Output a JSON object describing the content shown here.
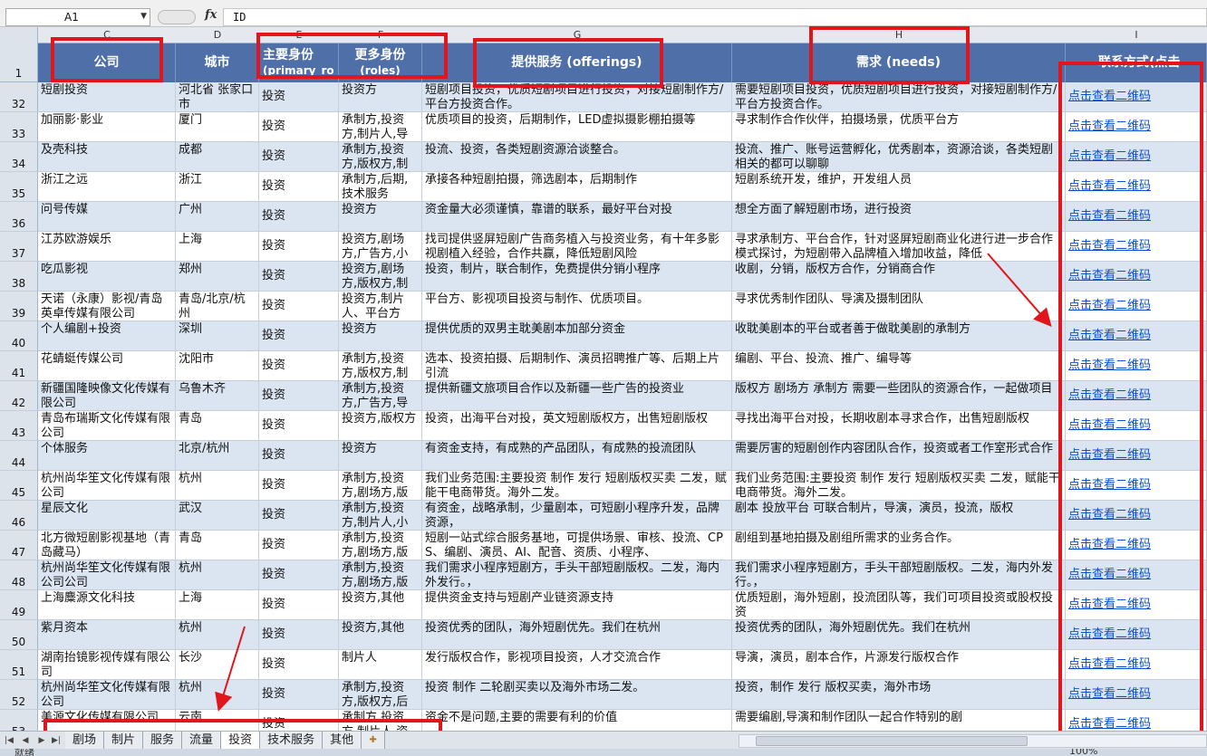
{
  "formula_bar": {
    "cell_ref": "A1",
    "fx": "fx",
    "value": "ID"
  },
  "column_letters": [
    "C",
    "D",
    "E",
    "F",
    "G",
    "H",
    "I"
  ],
  "headers": {
    "company": "公司",
    "city": "城市",
    "primary_line1": "主要身份",
    "primary_line2": "(primary_ro",
    "roles_line1": "更多身份",
    "roles_line2": "(roles)",
    "offerings": "提供服务 (offerings)",
    "needs": "需求 (needs)",
    "contact": "联系方式(点击"
  },
  "header_row_number": "1",
  "link_text": "点击查看二维码",
  "rows": [
    {
      "n": "32",
      "company": "短剧投资",
      "city": "河北省 张家口市",
      "primary": "投资",
      "roles": "投资方",
      "offer": "短剧项目投资，优质短剧项目进行投资，对接短剧制作方/平台方投资合作。",
      "need": "需要短剧项目投资，优质短剧项目进行投资，对接短剧制作方/平台方投资合作。"
    },
    {
      "n": "33",
      "company": "加丽影·影业",
      "city": "厦门",
      "primary": "投资",
      "roles": "承制方,投资方,制片人,导",
      "offer": "优质项目的投资，后期制作，LED虚拟摄影棚拍摄等",
      "need": "寻求制作合作伙伴，拍摄场景，优质平台方"
    },
    {
      "n": "34",
      "company": "及壳科技",
      "city": "成都",
      "primary": "投资",
      "roles": "承制方,投资方,版权方,制",
      "offer": "投流、投资，各类短剧资源洽谈整合。",
      "need": "投流、推广、账号运营孵化，优秀剧本，资源洽谈，各类短剧相关的都可以聊聊"
    },
    {
      "n": "35",
      "company": "浙江之远",
      "city": "浙江",
      "primary": "投资",
      "roles": "承制方,后期,技术服务",
      "offer": "承接各种短剧拍摄，筛选剧本，后期制作",
      "need": "短剧系统开发，维护，开发组人员"
    },
    {
      "n": "36",
      "company": "问号传媒",
      "city": "广州",
      "primary": "投资",
      "roles": "投资方",
      "offer": "资金量大必须谨慎，靠谱的联系，最好平台对投",
      "need": "想全方面了解短剧市场，进行投资"
    },
    {
      "n": "37",
      "company": "江苏欧游娱乐",
      "city": "上海",
      "primary": "投资",
      "roles": "投资方,剧场方,广告方,小",
      "offer": "找司提供竖屏短剧广告商务植入与投资业务，有十年多影视剧植入经验，合作共赢，降低短剧风险",
      "need": "寻求承制方、平台合作，针对竖屏短剧商业化进行进一步合作模式探讨，为短剧带入品牌植入增加收益，降低"
    },
    {
      "n": "38",
      "company": "吃瓜影视",
      "city": "郑州",
      "primary": "投资",
      "roles": "投资方,剧场方,版权方,制",
      "offer": "投资，制片，联合制作，免费提供分销小程序",
      "need": "收剧，分销，版权方合作，分销商合作"
    },
    {
      "n": "39",
      "company": "天诺（永康）影视/青岛英卓传媒有限公司",
      "city": "青岛/北京/杭州",
      "primary": "投资",
      "roles": "投资方,制片人、平台方",
      "offer": "平台方、影视项目投资与制作、优质项目。",
      "need": "寻求优秀制作团队、导演及摄制团队"
    },
    {
      "n": "40",
      "company": "个人编剧+投资",
      "city": "深圳",
      "primary": "投资",
      "roles": "投资方",
      "offer": "提供优质的双男主耽美剧本加部分资金",
      "need": "收耽美剧本的平台或者善于做耽美剧的承制方"
    },
    {
      "n": "41",
      "company": "花蜻蜓传媒公司",
      "city": "沈阳市",
      "primary": "投资",
      "roles": "承制方,投资方,版权方,制",
      "offer": "选本、投资拍摄、后期制作、演员招聘推广等、后期上片引流",
      "need": "编剧、平台、投流、推广、编导等"
    },
    {
      "n": "42",
      "company": "新疆国隆映像文化传媒有限公司",
      "city": "乌鲁木齐",
      "primary": "投资",
      "roles": "承制方,投资方,广告方,导",
      "offer": "提供新疆文旅项目合作以及新疆一些广告的投资业",
      "need": "版权方 剧场方 承制方 需要一些团队的资源合作，一起做项目"
    },
    {
      "n": "43",
      "company": "青岛布瑞斯文化传媒有限公司",
      "city": "青岛",
      "primary": "投资",
      "roles": "投资方,版权方",
      "offer": "投资，出海平台对投，英文短剧版权方，出售短剧版权",
      "need": "寻找出海平台对投，长期收剧本寻求合作，出售短剧版权"
    },
    {
      "n": "44",
      "company": "个体服务",
      "city": "北京/杭州",
      "primary": "投资",
      "roles": "投资方",
      "offer": "有资金支持，有成熟的产品团队，有成熟的投流团队",
      "need": "需要厉害的短剧创作内容团队合作，投资或者工作室形式合作"
    },
    {
      "n": "45",
      "company": "杭州尚华笙文化传媒有限公司",
      "city": "杭州",
      "primary": "投资",
      "roles": "承制方,投资方,剧场方,版",
      "offer": "我们业务范围:主要投资 制作 发行 短剧版权买卖 二发，赋能干电商带货。海外二发。",
      "need": "我们业务范围:主要投资 制作 发行 短剧版权买卖 二发，赋能干电商带货。海外二发。"
    },
    {
      "n": "46",
      "company": "星辰文化",
      "city": "武汉",
      "primary": "投资",
      "roles": "承制方,投资方,制片人,小",
      "offer": "有资金，战略承制，少量剧本，可短剧小程序升发，品牌资源，",
      "need": "剧本 投放平台 可联合制片，导演，演员，投流，版权"
    },
    {
      "n": "47",
      "company": "北方微短剧影视基地（青岛藏马）",
      "city": "青岛",
      "primary": "投资",
      "roles": "承制方,投资方,剧场方,版",
      "offer": "短剧一站式综合服务基地，可提供场景、审核、投流、CPS、编剧、演员、AI、配音、资质、小程序、",
      "need": "剧组到基地拍摄及剧组所需求的业务合作。"
    },
    {
      "n": "48",
      "company": "杭州尚华笙文化传媒有限公司公司",
      "city": "杭州",
      "primary": "投资",
      "roles": "承制方,投资方,剧场方,版",
      "offer": "我们需求小程序短剧方，手头干部短剧版权。二发，海内外发行。，",
      "need": "我们需求小程序短剧方，手头干部短剧版权。二发，海内外发行。，"
    },
    {
      "n": "49",
      "company": "上海麋源文化科技",
      "city": "上海",
      "primary": "投资",
      "roles": "投资方,其他",
      "offer": "提供资金支持与短剧产业链资源支持",
      "need": "优质短剧，海外短剧，投流团队等，我们可项目投资或股权投资"
    },
    {
      "n": "50",
      "company": "紫月资本",
      "city": "杭州",
      "primary": "投资",
      "roles": "投资方,其他",
      "offer": "投资优秀的团队，海外短剧优先。我们在杭州",
      "need": "投资优秀的团队，海外短剧优先。我们在杭州"
    },
    {
      "n": "51",
      "company": "湖南抬镜影视传媒有限公司",
      "city": "长沙",
      "primary": "投资",
      "roles": "制片人",
      "offer": "发行版权合作，影视项目投资，人才交流合作",
      "need": "导演，演员，剧本合作，片源发行版权合作"
    },
    {
      "n": "52",
      "company": "杭州尚华笙文化传媒有限公司",
      "city": "杭州",
      "primary": "投资",
      "roles": "承制方,投资方,版权方,后",
      "offer": "投资 制作 二轮剧买卖以及海外市场二发。",
      "need": "投资，制作 发行 版权买卖，海外市场"
    },
    {
      "n": "53",
      "company": "美源文化传媒有限公司",
      "city": "云南",
      "primary": "投资",
      "roles": "承制方,投资方,制片人,资",
      "offer": "资金不是问题,主要的需要有利的价值",
      "need": "需要编剧,导演和制作团队一起合作特别的剧"
    }
  ],
  "sheet_tabs": [
    "剧场",
    "制片",
    "服务",
    "流量",
    "投资",
    "技术服务",
    "其他"
  ],
  "active_tab": "投资",
  "status": {
    "ready": "就绪",
    "zoom": "100%"
  },
  "colors": {
    "header_bg": "#4f6fa8",
    "band": "#dbe5f1",
    "annotation": "#e0161c",
    "link": "#0b4fd2"
  }
}
